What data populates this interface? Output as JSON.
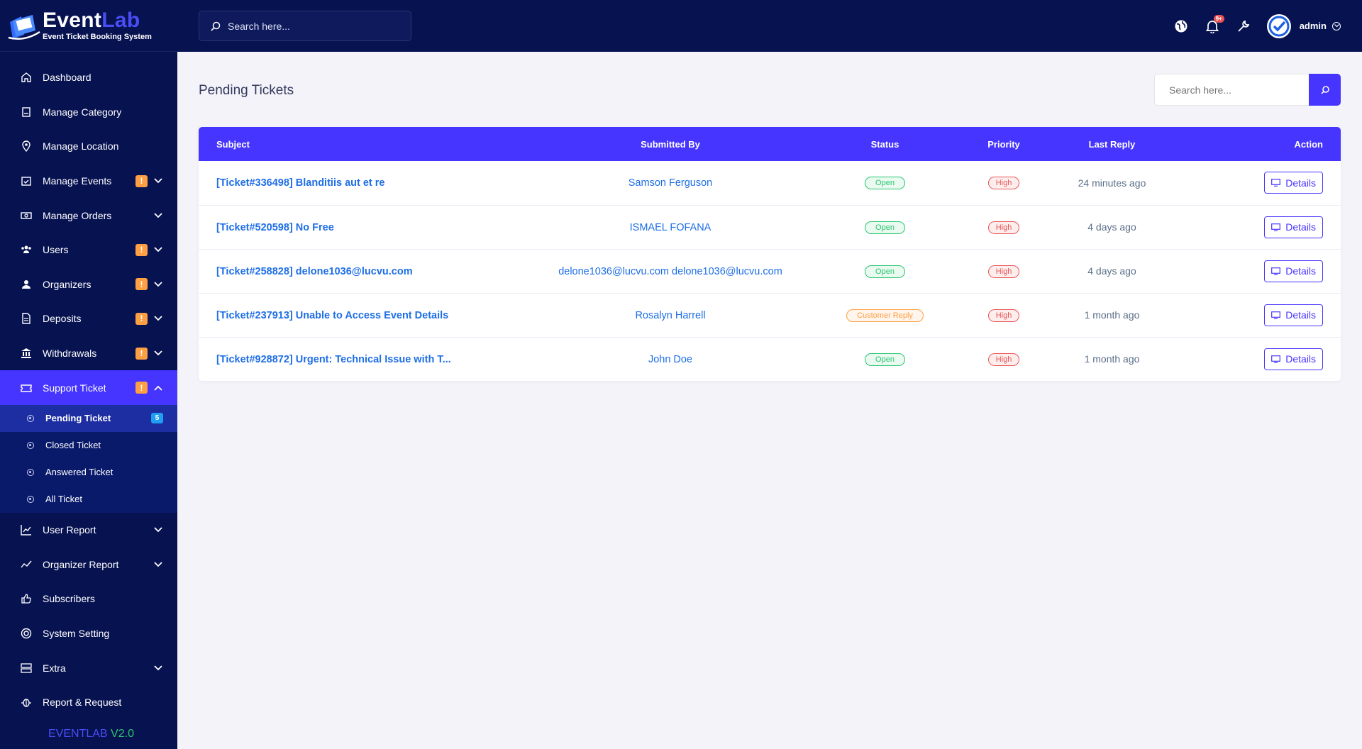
{
  "brand": {
    "name_part1": "Event",
    "name_part2": "Lab",
    "subtitle": "Event Ticket Booking System"
  },
  "topbar": {
    "search_placeholder": "Search here...",
    "notification_count": "9+",
    "user_name": "admin"
  },
  "sidebar": {
    "items": [
      {
        "label": "Dashboard",
        "icon": "home-icon"
      },
      {
        "label": "Manage Category",
        "icon": "book-icon"
      },
      {
        "label": "Manage Location",
        "icon": "map-pin-icon"
      },
      {
        "label": "Manage Events",
        "icon": "calendar-check-icon",
        "warn": "!"
      },
      {
        "label": "Manage Orders",
        "icon": "money-icon"
      },
      {
        "label": "Users",
        "icon": "users-icon",
        "warn": "!"
      },
      {
        "label": "Organizers",
        "icon": "organizers-icon",
        "warn": "!"
      },
      {
        "label": "Deposits",
        "icon": "file-invoice-icon",
        "warn": "!"
      },
      {
        "label": "Withdrawals",
        "icon": "bank-icon",
        "warn": "!"
      },
      {
        "label": "Support Ticket",
        "icon": "ticket-icon",
        "warn": "!"
      }
    ],
    "sub_items": [
      {
        "label": "Pending Ticket",
        "count": "5"
      },
      {
        "label": "Closed Ticket"
      },
      {
        "label": "Answered Ticket"
      },
      {
        "label": "All Ticket"
      }
    ],
    "items_after": [
      {
        "label": "User Report",
        "icon": "chart-icon"
      },
      {
        "label": "Organizer Report",
        "icon": "trend-icon"
      },
      {
        "label": "Subscribers",
        "icon": "thumbs-up-icon"
      },
      {
        "label": "System Setting",
        "icon": "life-ring-icon"
      },
      {
        "label": "Extra",
        "icon": "server-icon"
      },
      {
        "label": "Report & Request",
        "icon": "bug-icon"
      }
    ],
    "version_part1": "EVENTLAB",
    "version_part2": "V2.0"
  },
  "main": {
    "title": "Pending Tickets",
    "search_placeholder": "Search here...",
    "table": {
      "headers": {
        "subject": "Subject",
        "by": "Submitted By",
        "status": "Status",
        "priority": "Priority",
        "last": "Last Reply",
        "action": "Action"
      },
      "rows": [
        {
          "subject": "[Ticket#336498] Blanditiis aut et re",
          "by": "Samson Ferguson",
          "status": "Open",
          "priority": "High",
          "last": "24 minutes ago",
          "action": "Details"
        },
        {
          "subject": "[Ticket#520598] No Free",
          "by": "ISMAEL FOFANA",
          "status": "Open",
          "priority": "High",
          "last": "4 days ago",
          "action": "Details"
        },
        {
          "subject": "[Ticket#258828] delone1036@lucvu.com",
          "by": "delone1036@lucvu.com delone1036@lucvu.com",
          "status": "Open",
          "priority": "High",
          "last": "4 days ago",
          "action": "Details"
        },
        {
          "subject": "[Ticket#237913] Unable to Access Event Details",
          "by": "Rosalyn Harrell",
          "status": "Customer Reply",
          "priority": "High",
          "last": "1 month ago",
          "action": "Details"
        },
        {
          "subject": "[Ticket#928872] Urgent: Technical Issue with T...",
          "by": "John Doe",
          "status": "Open",
          "priority": "High",
          "last": "1 month ago",
          "action": "Details"
        }
      ]
    }
  }
}
